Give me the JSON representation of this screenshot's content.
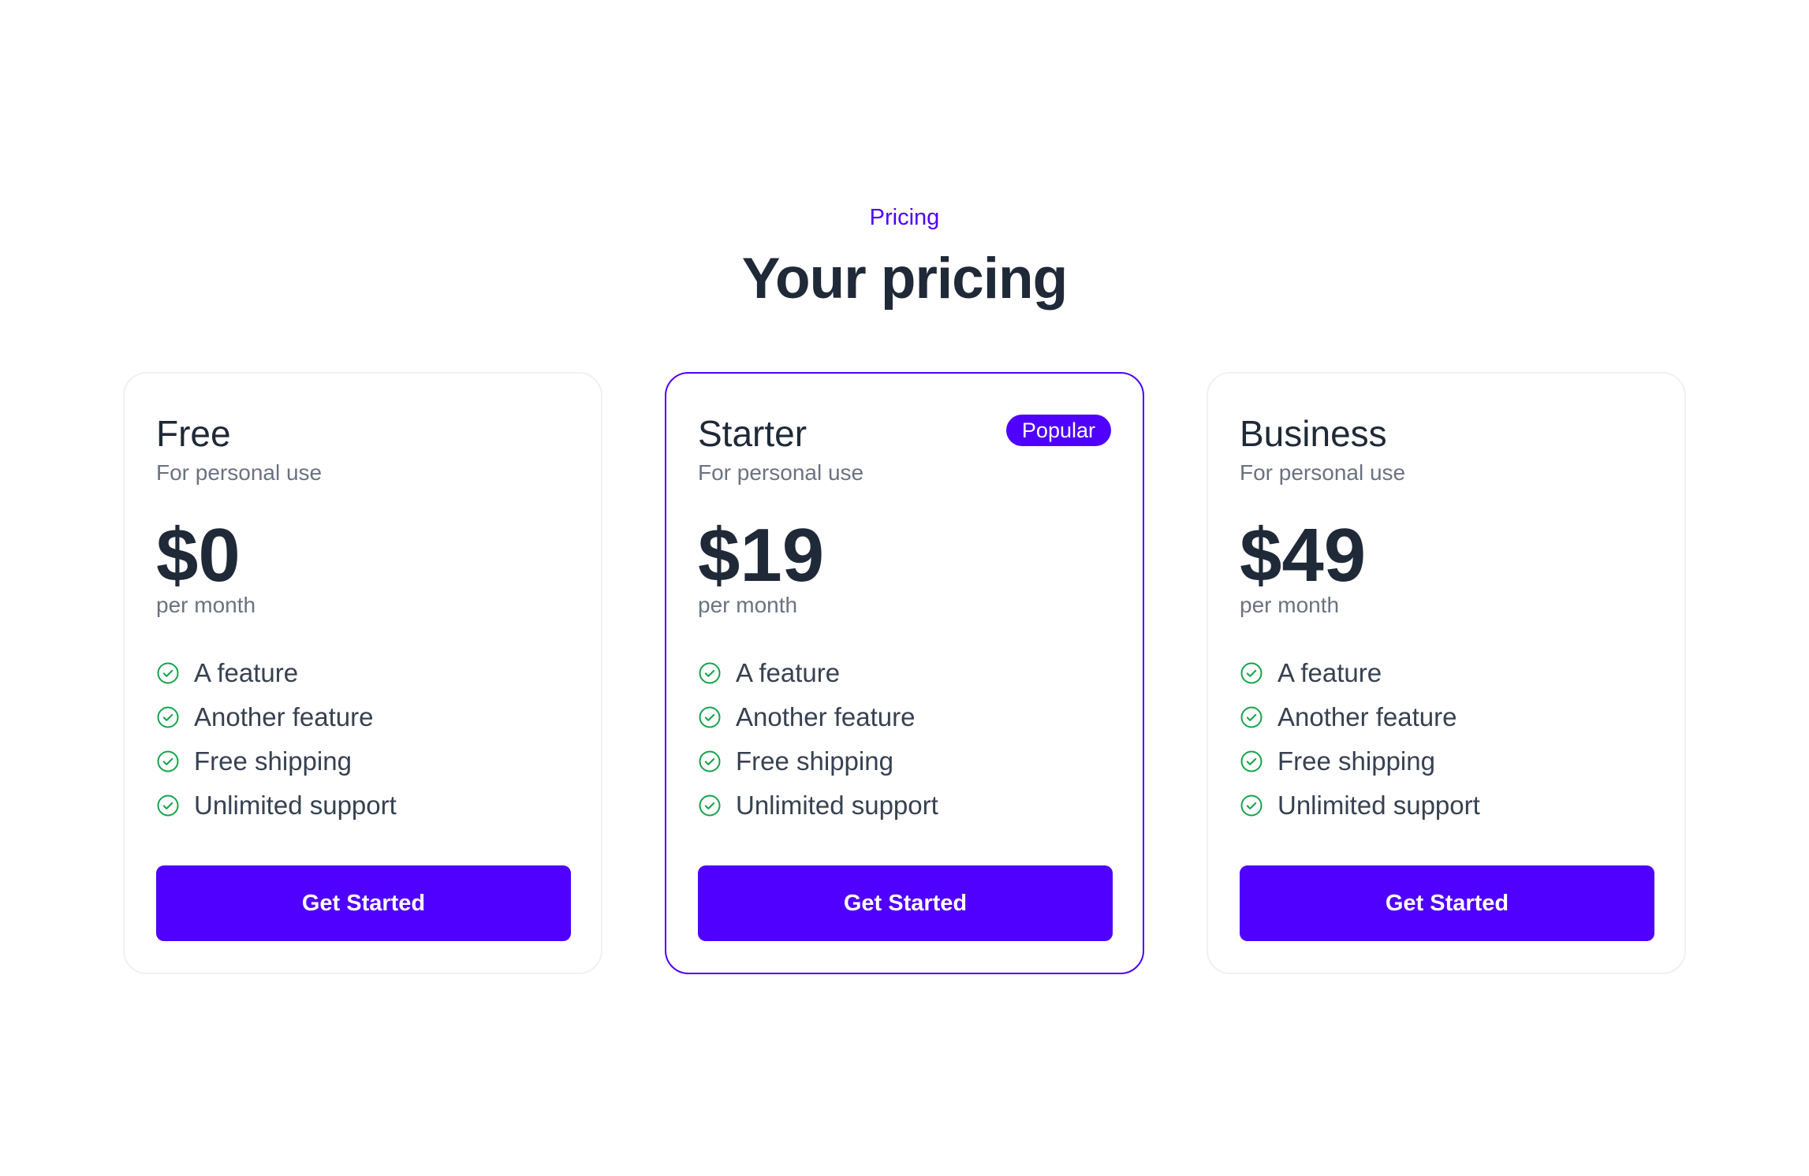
{
  "header": {
    "eyebrow": "Pricing",
    "title": "Your pricing"
  },
  "colors": {
    "accent": "#4f00ff",
    "check": "#16a34a",
    "text": "#1f2937",
    "muted": "#6b7280"
  },
  "plans": [
    {
      "name": "Free",
      "description": "For personal use",
      "price": "$0",
      "period": "per month",
      "features": [
        "A feature",
        "Another feature",
        "Free shipping",
        "Unlimited support"
      ],
      "cta": "Get Started"
    },
    {
      "name": "Starter",
      "badge": "Popular",
      "description": "For personal use",
      "price": "$19",
      "period": "per month",
      "features": [
        "A feature",
        "Another feature",
        "Free shipping",
        "Unlimited support"
      ],
      "cta": "Get Started"
    },
    {
      "name": "Business",
      "description": "For personal use",
      "price": "$49",
      "period": "per month",
      "features": [
        "A feature",
        "Another feature",
        "Free shipping",
        "Unlimited support"
      ],
      "cta": "Get Started"
    }
  ]
}
